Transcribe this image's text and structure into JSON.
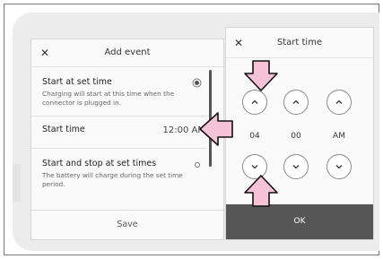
{
  "add_event": {
    "title": "Add event",
    "option1": {
      "title": "Start at set time",
      "description": "Charging will start at this time when the connector is plugged in."
    },
    "start_time": {
      "label": "Start time",
      "value": "12:00 AM"
    },
    "option2": {
      "title": "Start and stop at set times",
      "description": "The battery will charge during the set time period."
    },
    "save_label": "Save"
  },
  "start_time_dialog": {
    "title": "Start time",
    "hour": "04",
    "minute": "00",
    "period": "AM",
    "ok_label": "OK"
  },
  "colors": {
    "highlight_arrow": "#f6c3d6",
    "ok_button_bg": "#565656"
  },
  "icons": {
    "close": "close-icon",
    "kebab": "kebab-icon",
    "up": "chevron-up-icon",
    "down": "chevron-down-icon"
  }
}
